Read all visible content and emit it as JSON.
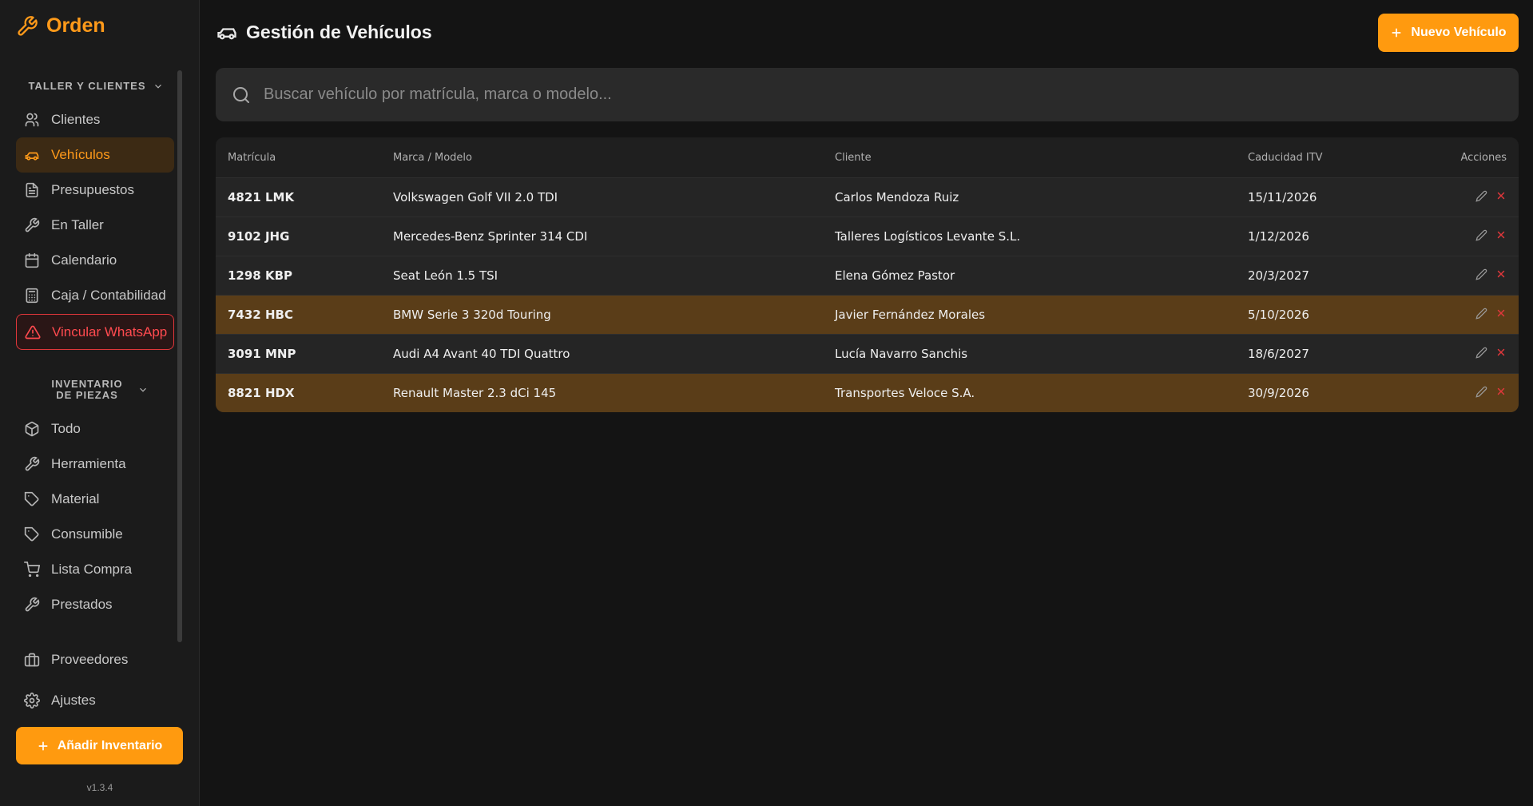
{
  "app": {
    "name": "Orden",
    "version": "v1.3.4"
  },
  "sidebar": {
    "section1": {
      "title": "TALLER Y CLIENTES"
    },
    "items1": [
      {
        "label": "Clientes",
        "icon": "users-icon"
      },
      {
        "label": "Vehículos",
        "icon": "car-icon",
        "active": true
      },
      {
        "label": "Presupuestos",
        "icon": "document-icon"
      },
      {
        "label": "En Taller",
        "icon": "wrench-icon"
      },
      {
        "label": "Calendario",
        "icon": "calendar-icon"
      },
      {
        "label": "Caja / Contabilidad",
        "icon": "calculator-icon"
      },
      {
        "label": "Vincular WhatsApp",
        "icon": "warning-icon",
        "warning": true
      }
    ],
    "section2": {
      "title": "INVENTARIO DE PIEZAS"
    },
    "items2": [
      {
        "label": "Todo",
        "icon": "box-icon"
      },
      {
        "label": "Herramienta",
        "icon": "wrench-icon"
      },
      {
        "label": "Material",
        "icon": "tag-icon"
      },
      {
        "label": "Consumible",
        "icon": "tag-icon"
      },
      {
        "label": "Lista Compra",
        "icon": "cart-icon"
      },
      {
        "label": "Prestados",
        "icon": "wrench-icon"
      }
    ],
    "bottom": [
      {
        "label": "Proveedores",
        "icon": "briefcase-icon"
      },
      {
        "label": "Ajustes",
        "icon": "gear-icon"
      }
    ],
    "add_button": "Añadir Inventario"
  },
  "main": {
    "title": "Gestión de Vehículos",
    "new_button": "Nuevo Vehículo",
    "search_placeholder": "Buscar vehículo por matrícula, marca o modelo...",
    "columns": [
      "Matrícula",
      "Marca / Modelo",
      "Cliente",
      "Caducidad ITV",
      "Acciones"
    ],
    "rows": [
      {
        "plate": "4821 LMK",
        "model": "Volkswagen Golf VII 2.0 TDI",
        "client": "Carlos Mendoza Ruiz",
        "itv": "15/11/2026",
        "highlight": false
      },
      {
        "plate": "9102 JHG",
        "model": "Mercedes-Benz Sprinter 314 CDI",
        "client": "Talleres Logísticos Levante S.L.",
        "itv": "1/12/2026",
        "highlight": false
      },
      {
        "plate": "1298 KBP",
        "model": "Seat León 1.5 TSI",
        "client": "Elena Gómez Pastor",
        "itv": "20/3/2027",
        "highlight": false
      },
      {
        "plate": "7432 HBC",
        "model": "BMW Serie 3 320d Touring",
        "client": "Javier Fernández Morales",
        "itv": "5/10/2026",
        "highlight": true
      },
      {
        "plate": "3091 MNP",
        "model": "Audi A4 Avant 40 TDI Quattro",
        "client": "Lucía Navarro Sanchis",
        "itv": "18/6/2027",
        "highlight": false
      },
      {
        "plate": "8821 HDX",
        "model": "Renault Master 2.3 dCi 145",
        "client": "Transportes Veloce S.A.",
        "itv": "30/9/2026",
        "highlight": true
      }
    ]
  },
  "colors": {
    "accent": "#ff9a0f",
    "danger": "#e0373b",
    "highlight_row": "#5a3d18"
  }
}
